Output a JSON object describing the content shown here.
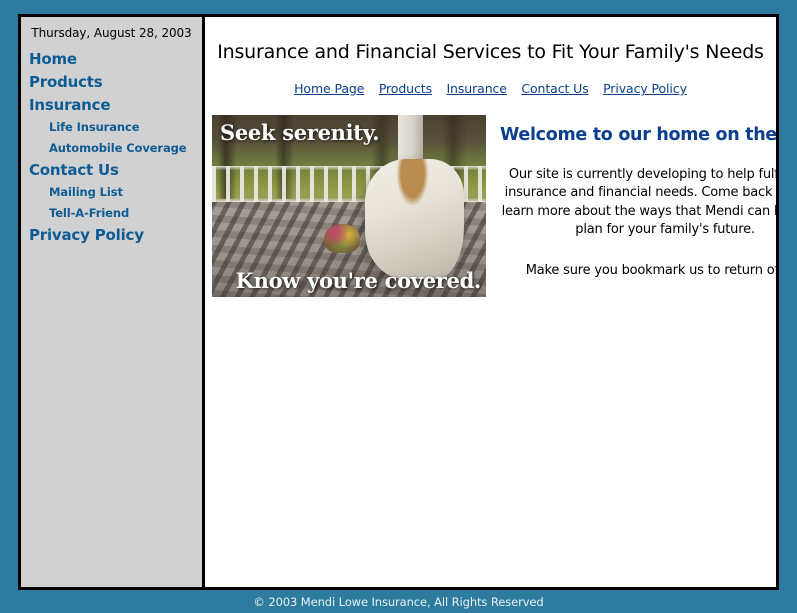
{
  "colors": {
    "frame_teal": "#2d7b9e",
    "sidebar_gray": "#d1d1d1",
    "sidebar_link_blue": "#0d5c94",
    "heading_blue": "#0d3f8f",
    "content_white": "#ffffff",
    "border_black": "#000000"
  },
  "sidebar": {
    "date": "Thursday, August 28, 2003",
    "items": [
      {
        "label": "Home",
        "level": 0
      },
      {
        "label": "Products",
        "level": 0
      },
      {
        "label": "Insurance",
        "level": 0
      },
      {
        "label": "Life Insurance",
        "level": 1
      },
      {
        "label": "Automobile Coverage",
        "level": 1
      },
      {
        "label": "Contact Us",
        "level": 0
      },
      {
        "label": "Mailing List",
        "level": 1
      },
      {
        "label": "Tell-A-Friend",
        "level": 1
      },
      {
        "label": "Privacy Policy",
        "level": 0
      }
    ]
  },
  "header": {
    "title": "Insurance and Financial Services to Fit Your Family's Needs",
    "nav_links": [
      {
        "label": "Home Page"
      },
      {
        "label": "Products"
      },
      {
        "label": "Insurance"
      },
      {
        "label": "Contact Us"
      },
      {
        "label": "Privacy Policy"
      }
    ]
  },
  "hero": {
    "caption_top": "Seek serenity.",
    "caption_bottom": "Know you're covered.",
    "alt": "Woman in a white dress reading a book while seated on a sunlit porch with a white railing and a basket of flowers"
  },
  "welcome": {
    "heading": "Welcome to our home on the web!",
    "paragraph": "Our site is currently developing to help fulfill your insurance and financial needs.  Come back often to learn more about the ways that Mendi can help you plan for your family's future.",
    "bookmark": "Make sure you bookmark us to return often!"
  },
  "footer": {
    "copyright": "© 2003 Mendi Lowe Insurance, All Rights Reserved"
  }
}
